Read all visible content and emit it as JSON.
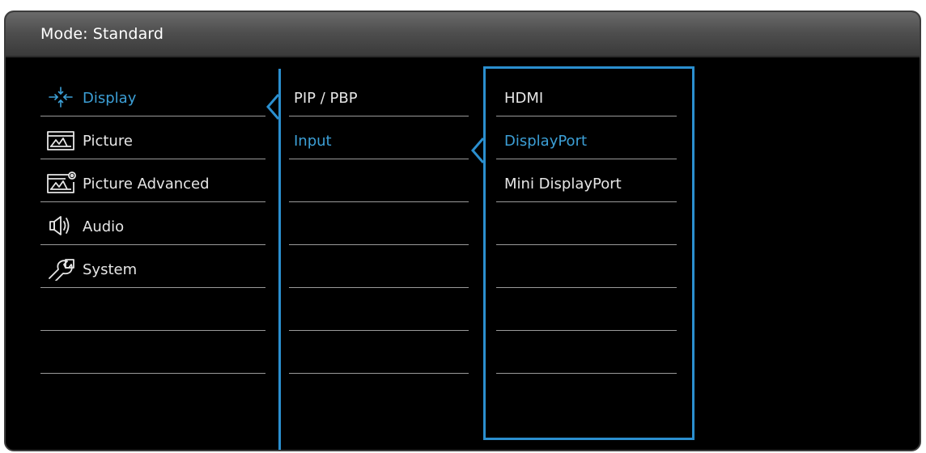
{
  "header": {
    "mode_label": "Mode: Standard"
  },
  "main_menu": {
    "items": [
      {
        "label": "Display",
        "icon": "display-icon",
        "active": true
      },
      {
        "label": "Picture",
        "icon": "picture-icon",
        "active": false
      },
      {
        "label": "Picture Advanced",
        "icon": "picture-advanced-icon",
        "active": false
      },
      {
        "label": "Audio",
        "icon": "audio-icon",
        "active": false
      },
      {
        "label": "System",
        "icon": "system-icon",
        "active": false
      },
      {
        "label": ""
      },
      {
        "label": ""
      }
    ]
  },
  "sub_menu": {
    "items": [
      {
        "label": "PIP / PBP",
        "active": false
      },
      {
        "label": "Input",
        "active": true
      },
      {
        "label": ""
      },
      {
        "label": ""
      },
      {
        "label": ""
      },
      {
        "label": ""
      },
      {
        "label": ""
      }
    ]
  },
  "options_menu": {
    "items": [
      {
        "label": "HDMI",
        "active": false
      },
      {
        "label": "DisplayPort",
        "active": true
      },
      {
        "label": "Mini DisplayPort",
        "active": false
      },
      {
        "label": ""
      },
      {
        "label": ""
      },
      {
        "label": ""
      },
      {
        "label": ""
      }
    ]
  },
  "colors": {
    "accent": "#2b8fcf",
    "active_text": "#3c9fd6",
    "text": "#e6e6e6",
    "background": "#000000"
  }
}
